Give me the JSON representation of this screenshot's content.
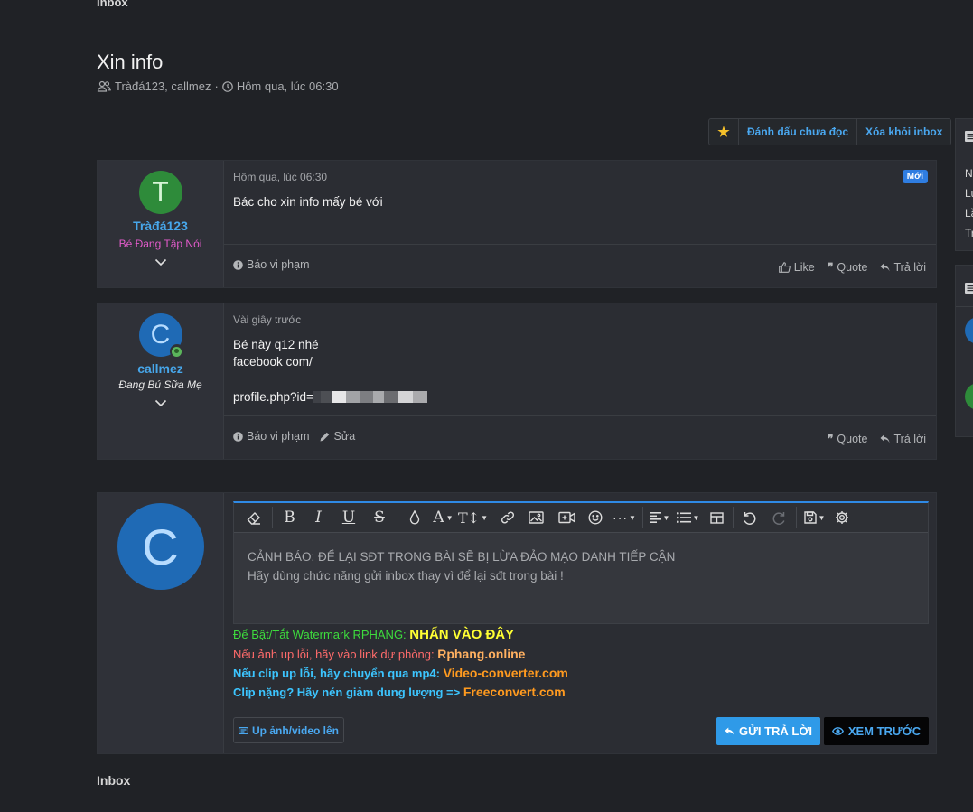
{
  "breadcrumb": {
    "top": "Inbox",
    "bottom": "Inbox"
  },
  "thread": {
    "title": "Xin info",
    "participants": "Tràđá123, callmez",
    "separator": "·",
    "time": "Hôm qua, lúc 06:30"
  },
  "actions": {
    "star_icon": "star-icon",
    "mark_unread": "Đánh dấu chưa đọc",
    "remove": "Xóa khỏi inbox"
  },
  "messages": [
    {
      "avatar_letter": "T",
      "username": "Tràđá123",
      "user_title": "Bé Đang Tập Nói",
      "date": "Hôm qua, lúc 06:30",
      "badge": "Mới",
      "body": [
        "Bác cho xin info mấy bé với"
      ],
      "footer_left": [
        "Báo vi phạm"
      ],
      "footer_right": [
        "Like",
        "Quote",
        "Trả lời"
      ]
    },
    {
      "avatar_letter": "C",
      "username": "callmez",
      "user_title": "Đang Bú Sữa Mẹ",
      "date": "Vài giây trước",
      "body": [
        "Bé này q12 nhé",
        "facebook com/",
        "",
        "profile.php?id="
      ],
      "footer_left": [
        "Báo vi phạm",
        "Sửa"
      ],
      "footer_right": [
        "Quote",
        "Trả lời"
      ]
    }
  ],
  "reply": {
    "avatar_letter": "C",
    "placeholder_line1": "CẢNH BÁO: ĐỂ LẠI SĐT TRONG BÀI SẼ BỊ LỪA ĐẢO MẠO DANH TIẾP CẬN",
    "placeholder_line2": "Hãy dùng chức năng gửi inbox thay vì để lại sđt trong bài !",
    "promos": [
      {
        "text": "Để Bật/Tắt Watermark RPHANG: ",
        "link": "NHẤN VÀO ĐÂY",
        "color": "#3ddc3d",
        "link_color": "#ffff33"
      },
      {
        "text": "Nếu ảnh up lỗi, hãy vào link dự phòng: ",
        "link": "Rphang.online",
        "color": "#ff6b6b",
        "link_color": "#ffb060"
      },
      {
        "text": "Nếu clip up lỗi, hãy chuyển qua mp4: ",
        "link": "Video-converter.com",
        "color": "#3cc5ff",
        "link_color": "#ff9a1f"
      },
      {
        "text": "Clip nặng? Hãy nén giảm dung lượng => ",
        "link": "Freeconvert.com",
        "color": "#3cc5ff",
        "link_color": "#ff9a1f"
      }
    ],
    "upload_label": "Up ảnh/video lên",
    "send_label": "GỬI TRẢ LỜI",
    "preview_label": "XEM TRƯỚC"
  },
  "sidebar_letters": [
    "N",
    "Lư",
    "Lầ",
    "Tr"
  ]
}
